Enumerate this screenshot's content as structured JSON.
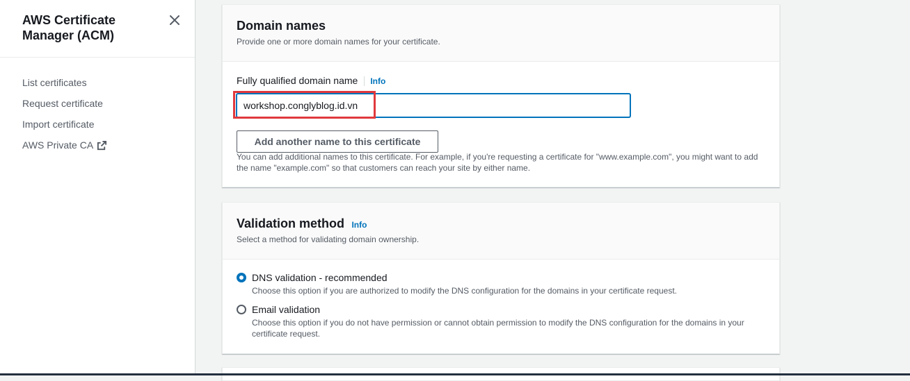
{
  "sidebar": {
    "title": "AWS Certificate Manager (ACM)",
    "items": [
      {
        "label": "List certificates"
      },
      {
        "label": "Request certificate"
      },
      {
        "label": "Import certificate"
      },
      {
        "label": "AWS Private CA",
        "icon": "external-link-icon"
      }
    ]
  },
  "domain_panel": {
    "title": "Domain names",
    "description": "Provide one or more domain names for your certificate.",
    "field_label": "Fully qualified domain name",
    "info": "Info",
    "input_value": "workshop.conglyblog.id.vn",
    "add_button": "Add another name to this certificate",
    "hint": "You can add additional names to this certificate. For example, if you're requesting a certificate for \"www.example.com\", you might want to add the name \"example.com\" so that customers can reach your site by either name."
  },
  "validation_panel": {
    "title": "Validation method",
    "info": "Info",
    "description": "Select a method for validating domain ownership.",
    "options": [
      {
        "label": "DNS validation - recommended",
        "description": "Choose this option if you are authorized to modify the DNS configuration for the domains in your certificate request.",
        "selected": true
      },
      {
        "label": "Email validation",
        "description": "Choose this option if you do not have permission or cannot obtain permission to modify the DNS configuration for the domains in your certificate request.",
        "selected": false
      }
    ]
  },
  "colors": {
    "accent": "#0073bb",
    "highlight": "#e0393e",
    "text": "#16191f",
    "muted": "#545b64"
  }
}
